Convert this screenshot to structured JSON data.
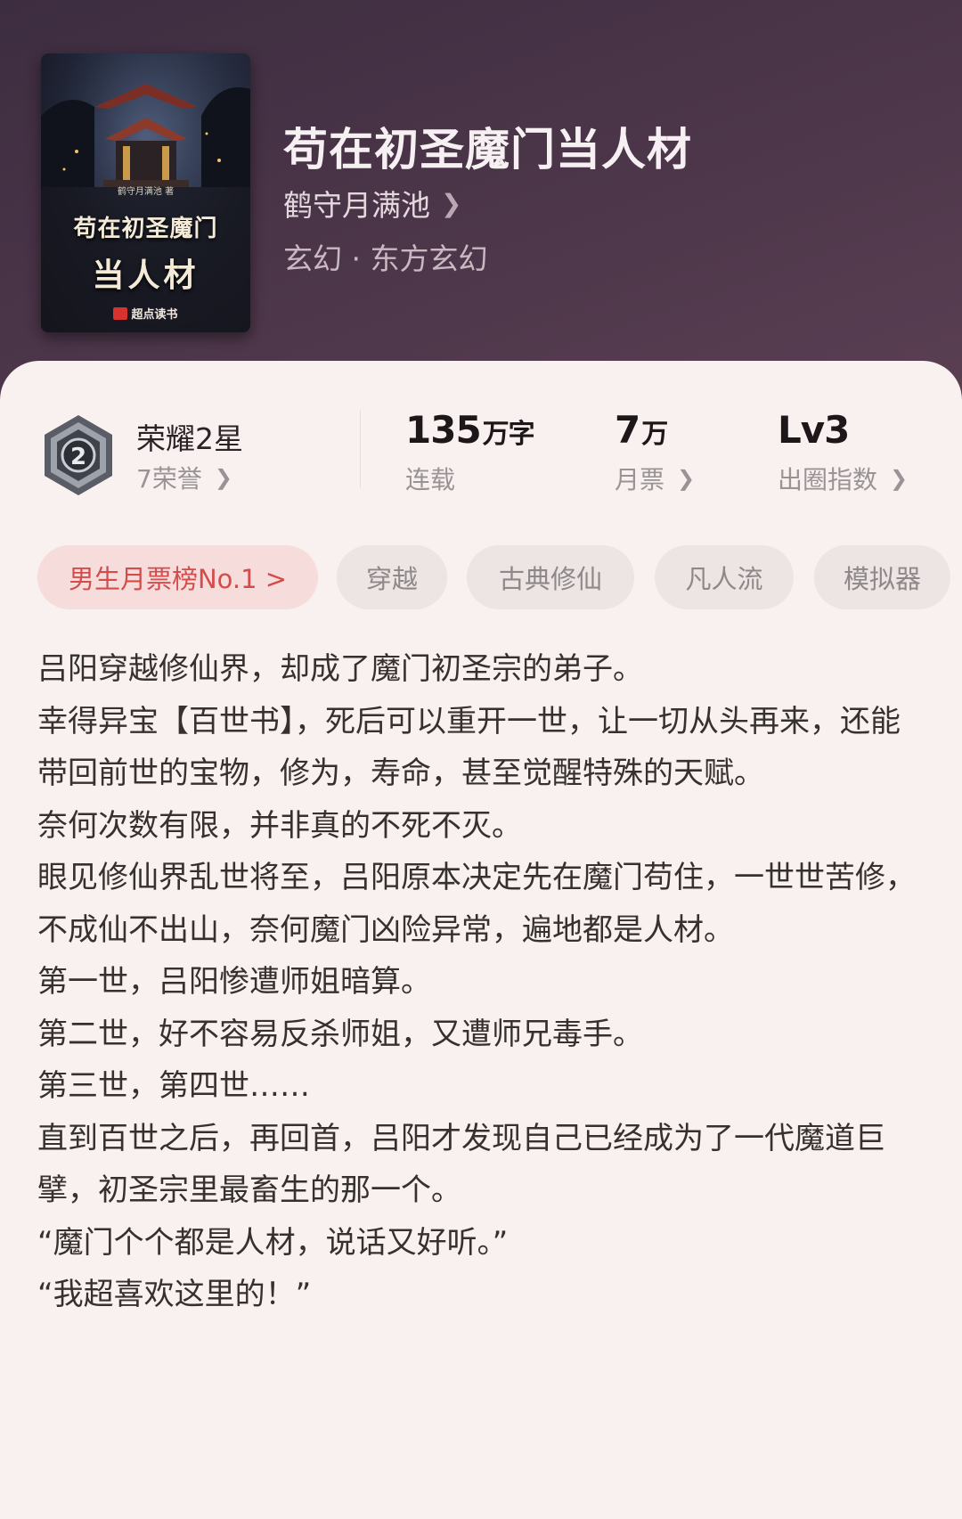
{
  "book": {
    "title": "苟在初圣魔门当人材",
    "author": "鹤守月满池",
    "genre": "玄幻 · 东方玄幻",
    "cover": {
      "author_line": "鹤守月满池 著",
      "title_line1": "苟在初圣魔门",
      "title_line2": "当人材",
      "publisher": "超点读书"
    }
  },
  "honor": {
    "title": "荣耀2星",
    "subtitle": "7荣誉",
    "badge_number": "2"
  },
  "stats": [
    {
      "value": "135",
      "unit": "万字",
      "label": "连载",
      "has_chevron": false
    },
    {
      "value": "7",
      "unit": "万",
      "label": "月票",
      "has_chevron": true
    },
    {
      "value": "Lv3",
      "unit": "",
      "label": "出圈指数",
      "has_chevron": true
    }
  ],
  "tags": [
    {
      "label": "男生月票榜No.1 >",
      "highlight": true
    },
    {
      "label": "穿越",
      "highlight": false
    },
    {
      "label": "古典修仙",
      "highlight": false
    },
    {
      "label": "凡人流",
      "highlight": false
    },
    {
      "label": "模拟器",
      "highlight": false
    }
  ],
  "description": [
    "吕阳穿越修仙界，却成了魔门初圣宗的弟子。",
    "幸得异宝【百世书】，死后可以重开一世，让一切从头再来，还能带回前世的宝物，修为，寿命，甚至觉醒特殊的天赋。",
    "奈何次数有限，并非真的不死不灭。",
    "眼见修仙界乱世将至，吕阳原本决定先在魔门苟住，一世世苦修，不成仙不出山，奈何魔门凶险异常，遍地都是人材。",
    "第一世，吕阳惨遭师姐暗算。",
    "第二世，好不容易反杀师姐，又遭师兄毒手。",
    "第三世，第四世……",
    "直到百世之后，再回首，吕阳才发现自己已经成为了一代魔道巨擘，初圣宗里最畜生的那一个。",
    "“魔门个个都是人材，说话又好听。”",
    "“我超喜欢这里的！”"
  ],
  "colors": {
    "header_bg": "#4a3448",
    "card_bg": "#f8f1ef",
    "rank_tag_bg": "#f6dcdb",
    "rank_tag_text": "#d24d4c",
    "tag_bg": "#ece5e3"
  }
}
